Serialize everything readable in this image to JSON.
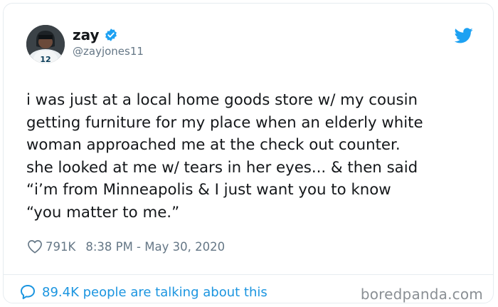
{
  "tweet": {
    "display_name": "zay",
    "handle": "@zayjones11",
    "text_lines": [
      "i was just at a local home goods store w/ my cousin",
      "getting furniture for my place when an elderly white",
      "woman approached me at the check out counter.",
      "she looked at me w/ tears in her eyes... & then said",
      "“i’m from Minneapolis & I just want you to know",
      "“you matter to me.”"
    ],
    "likes": "791K",
    "timestamp": "8:38 PM - May 30, 2020",
    "talking": "89.4K people are talking about this",
    "avatar_jersey_number": "12"
  },
  "watermark": "boredpanda.com",
  "icons": {
    "verified": "verified-badge-icon",
    "bird": "twitter-bird-icon",
    "heart": "heart-icon",
    "bubble": "speech-bubble-icon"
  },
  "colors": {
    "twitter_blue": "#1da1f2",
    "text": "#14171a",
    "muted": "#657786",
    "link_blue": "#1b95e0"
  }
}
